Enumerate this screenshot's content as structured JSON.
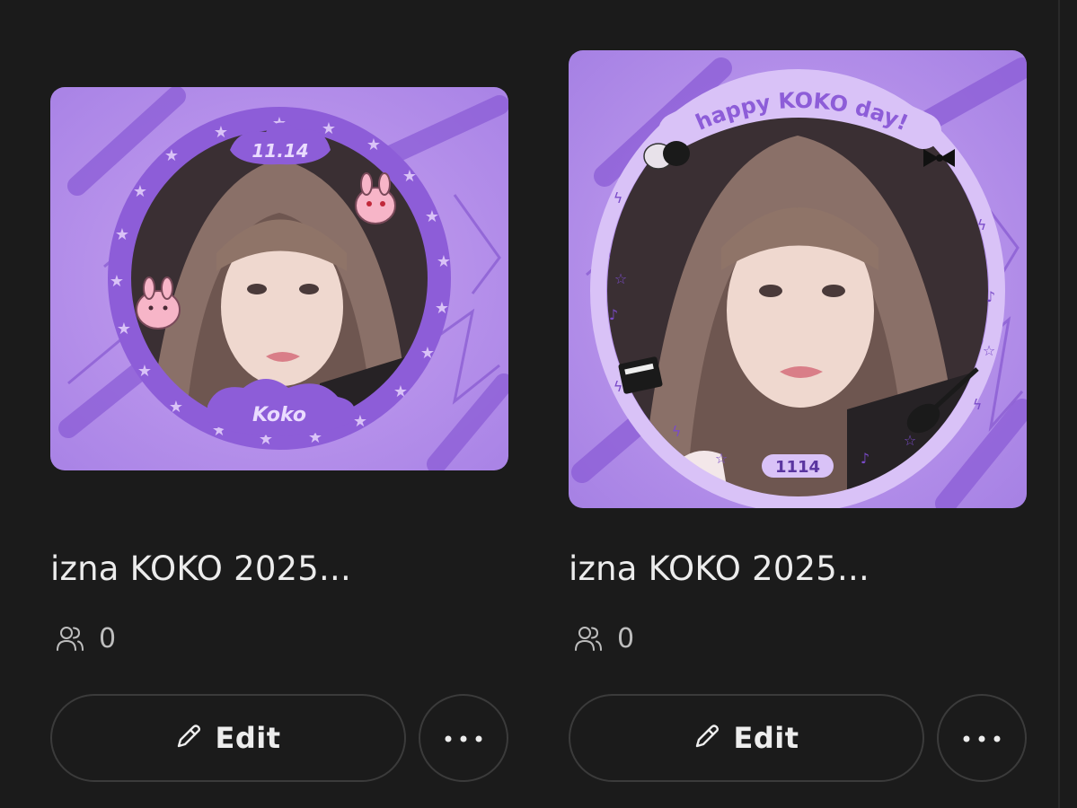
{
  "cards": [
    {
      "title": "izna KOKO 2025...",
      "member_count": "0",
      "edit_label": "Edit",
      "frame_date": "11.14",
      "frame_name": "Koko"
    },
    {
      "title": "izna KOKO 2025...",
      "member_count": "0",
      "edit_label": "Edit",
      "frame_banner": "happy KOKO day!",
      "frame_date": "1114"
    }
  ],
  "icons": {
    "members": "users-icon",
    "edit": "pencil-icon",
    "more": "more-horizontal-icon"
  },
  "colors": {
    "background": "#1b1b1b",
    "text": "#ececec",
    "muted": "#bdbdbd",
    "border": "#3b3b3b",
    "frame_purple": "#9b6fd6",
    "frame_light": "#d9c2f7"
  }
}
